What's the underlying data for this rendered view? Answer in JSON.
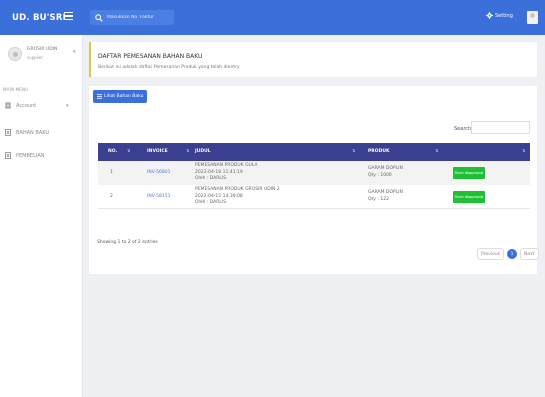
{
  "brand": "UD. BU'SRI",
  "search": {
    "placeholder": "Masukkan No. Faktur"
  },
  "topbar": {
    "setting_label": "Setting"
  },
  "user": {
    "name": "GROSIR UDIN",
    "role": "supplier"
  },
  "sidebar": {
    "heading": "MAIN MENU",
    "items": [
      {
        "label": "Account",
        "icon": "account-icon"
      },
      {
        "label": "BAHAN BAKU",
        "icon": "document-icon"
      },
      {
        "label": "PEMBELIAN",
        "icon": "document-icon"
      }
    ]
  },
  "header": {
    "title": "DAFTAR PEMESANAN BAHAN BAKU",
    "subtitle": "Berikut ini adalah daftar Pemesanan Produk yang telah dientry"
  },
  "main": {
    "list_button": "Lihat Bahan Baku",
    "search_label": "Search:",
    "table": {
      "columns": [
        "NO.",
        "INVOICE",
        "JUDUL",
        "PRODUK",
        ""
      ],
      "rows": [
        {
          "no": "1",
          "invoice": "INV-56801",
          "judul": [
            "PEMESANAN PRODUK GULA",
            "2022-04-18 11:41:19",
            "Oleh : DARLIS"
          ],
          "produk": [
            "GARAM DOPLIN",
            "Qty : 1000"
          ],
          "action": "Telah diapproval"
        },
        {
          "no": "2",
          "invoice": "INV-58151",
          "judul": [
            "PEMESANAN PRODUK GROSIR UDIN 2",
            "2022-04-15 14:39:08",
            "Oleh : DARLIS"
          ],
          "produk": [
            "GARAM DOPLIN",
            "Qty : 122"
          ],
          "action": "Telah diapproval"
        }
      ]
    },
    "info": "Showing 1 to 2 of 2 entries",
    "pagination": {
      "previous": "Previous",
      "current": "1",
      "next": "Next"
    }
  },
  "colors": {
    "topbar": "#3b6fd9",
    "table_header": "#3a3f8f",
    "success": "#1ec133",
    "header_accent": "#d9c84a"
  }
}
